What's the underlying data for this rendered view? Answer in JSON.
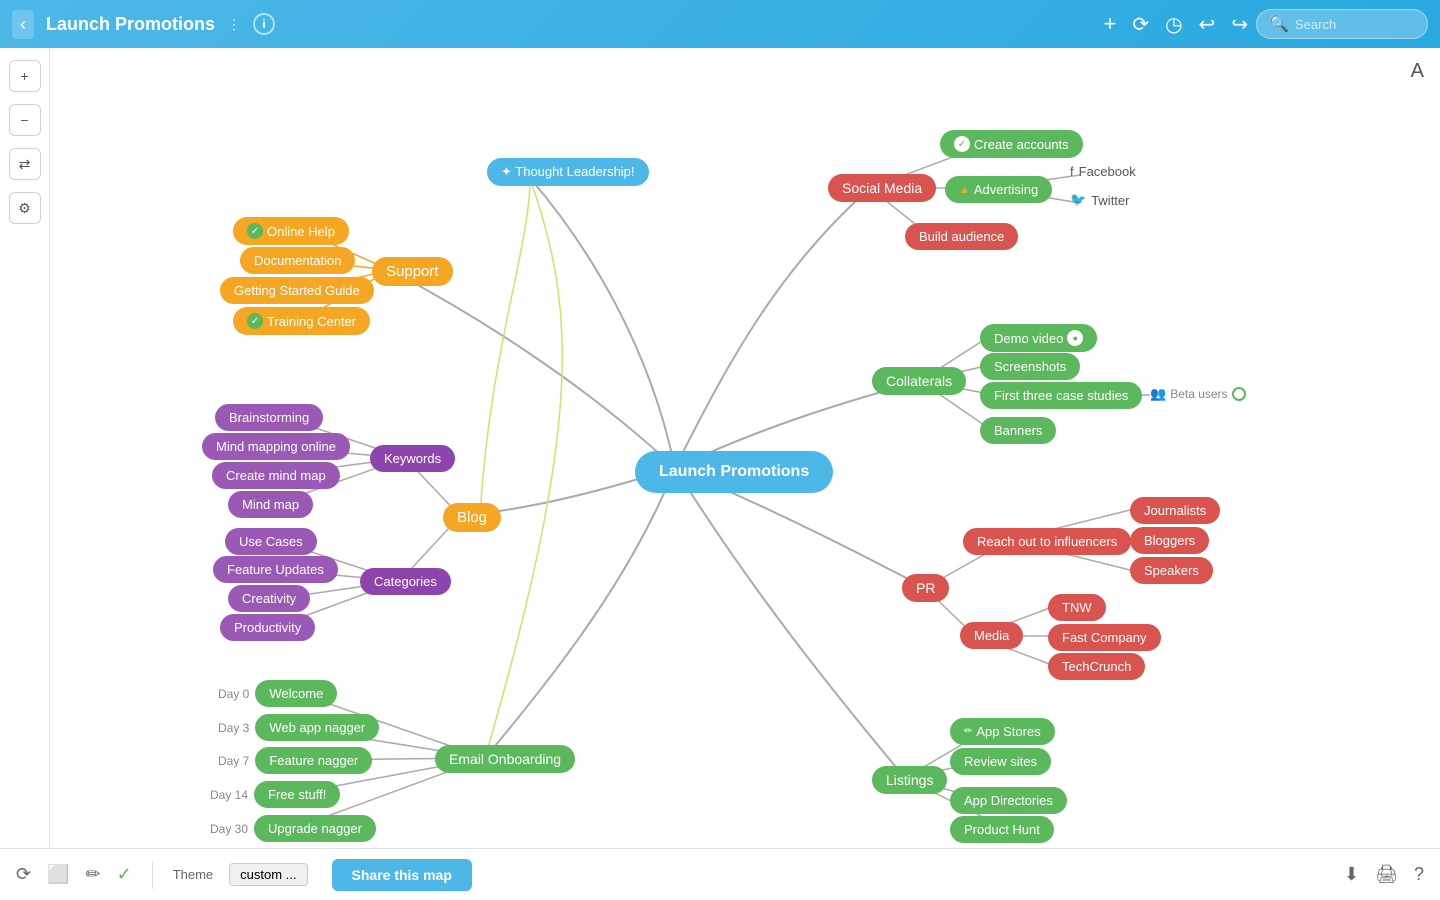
{
  "header": {
    "back_label": "‹",
    "title": "Launch Promotions",
    "title_arrow": "⋮",
    "info_label": "i",
    "actions": {
      "add": "+",
      "redo_alt": "⟳",
      "clock": "◷",
      "undo": "↩",
      "redo": "↪"
    },
    "search_placeholder": "Search",
    "avatar": "A"
  },
  "sidebar": {
    "zoom_in": "+",
    "zoom_out": "−",
    "shuffle": "⇄",
    "settings": "⚙"
  },
  "canvas": {
    "central_node": "Launch Promotions",
    "branches": {
      "thought_leadership": {
        "label": "✦ Thought Leadership!",
        "type": "blue"
      },
      "support": {
        "label": "Support",
        "type": "orange",
        "children": [
          "Online Help",
          "Documentation",
          "Getting Started Guide",
          "Training Center"
        ]
      },
      "blog": {
        "label": "Blog",
        "type": "orange",
        "children": {
          "keywords": {
            "label": "Keywords",
            "items": [
              "Brainstorming",
              "Mind mapping online",
              "Create mind map",
              "Mind map"
            ]
          },
          "categories": {
            "label": "Categories",
            "items": [
              "Use Cases",
              "Feature Updates",
              "Creativity",
              "Productivity"
            ]
          }
        }
      },
      "email_onboarding": {
        "label": "Email Onboarding",
        "type": "green_dark",
        "children": [
          {
            "day": "Day 0",
            "label": "Welcome"
          },
          {
            "day": "Day 3",
            "label": "Web app nagger"
          },
          {
            "day": "Day 7",
            "label": "Feature nagger"
          },
          {
            "day": "Day 14",
            "label": "Free stuff!"
          },
          {
            "day": "Day 30",
            "label": "Upgrade nagger"
          }
        ]
      },
      "social_media": {
        "label": "Social Media",
        "type": "red",
        "children": {
          "create_accounts": "Create accounts",
          "advertising": {
            "label": "Advertising",
            "items": [
              "Facebook",
              "Twitter"
            ]
          },
          "build_audience": "Build audience"
        }
      },
      "collaterals": {
        "label": "Collaterals",
        "type": "green",
        "children": [
          "Demo video",
          "Screenshots",
          "First three case studies",
          "Banners"
        ],
        "beta_users": "Beta users"
      },
      "pr": {
        "label": "PR",
        "type": "red",
        "children": {
          "reach_out": {
            "label": "Reach out to influencers",
            "items": [
              "Journalists",
              "Bloggers",
              "Speakers"
            ]
          },
          "media": {
            "label": "Media",
            "items": [
              "TNW",
              "Fast Company",
              "TechCrunch"
            ]
          }
        }
      },
      "listings": {
        "label": "Listings",
        "type": "green_dark",
        "children": [
          "App Stores",
          "Review sites",
          "App Directories",
          "Product Hunt"
        ]
      }
    }
  },
  "bottom": {
    "theme_label": "Theme",
    "theme_value": "custom ...",
    "share_label": "Share this map"
  }
}
